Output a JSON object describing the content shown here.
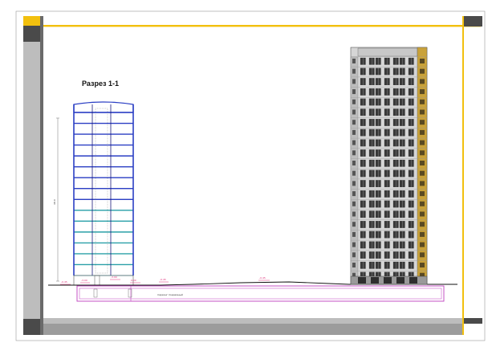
{
  "drawing": {
    "section_title": "Разрез 1-1",
    "elev_left": "-0.45",
    "elev_a": "-3.00",
    "elev_b": "-3.00",
    "elev_c": "0.00",
    "elev_mid": "-0.45",
    "elev_road": "-0.45",
    "height_dim": "48.0",
    "underground_label": "паркинг подземный"
  },
  "colors": {
    "frame_yellow": "#f2c00e",
    "frame_dark": "#4a4a4a",
    "frame_gray": "#bdbdbd",
    "section_blue": "#2b3fc4",
    "section_cyan": "#2aa0a8",
    "facade_panel": "#d6d6d6",
    "window_dark": "#3a3a3a",
    "accent_ochre": "#c9a23a",
    "underground_magenta": "#c040c0"
  }
}
